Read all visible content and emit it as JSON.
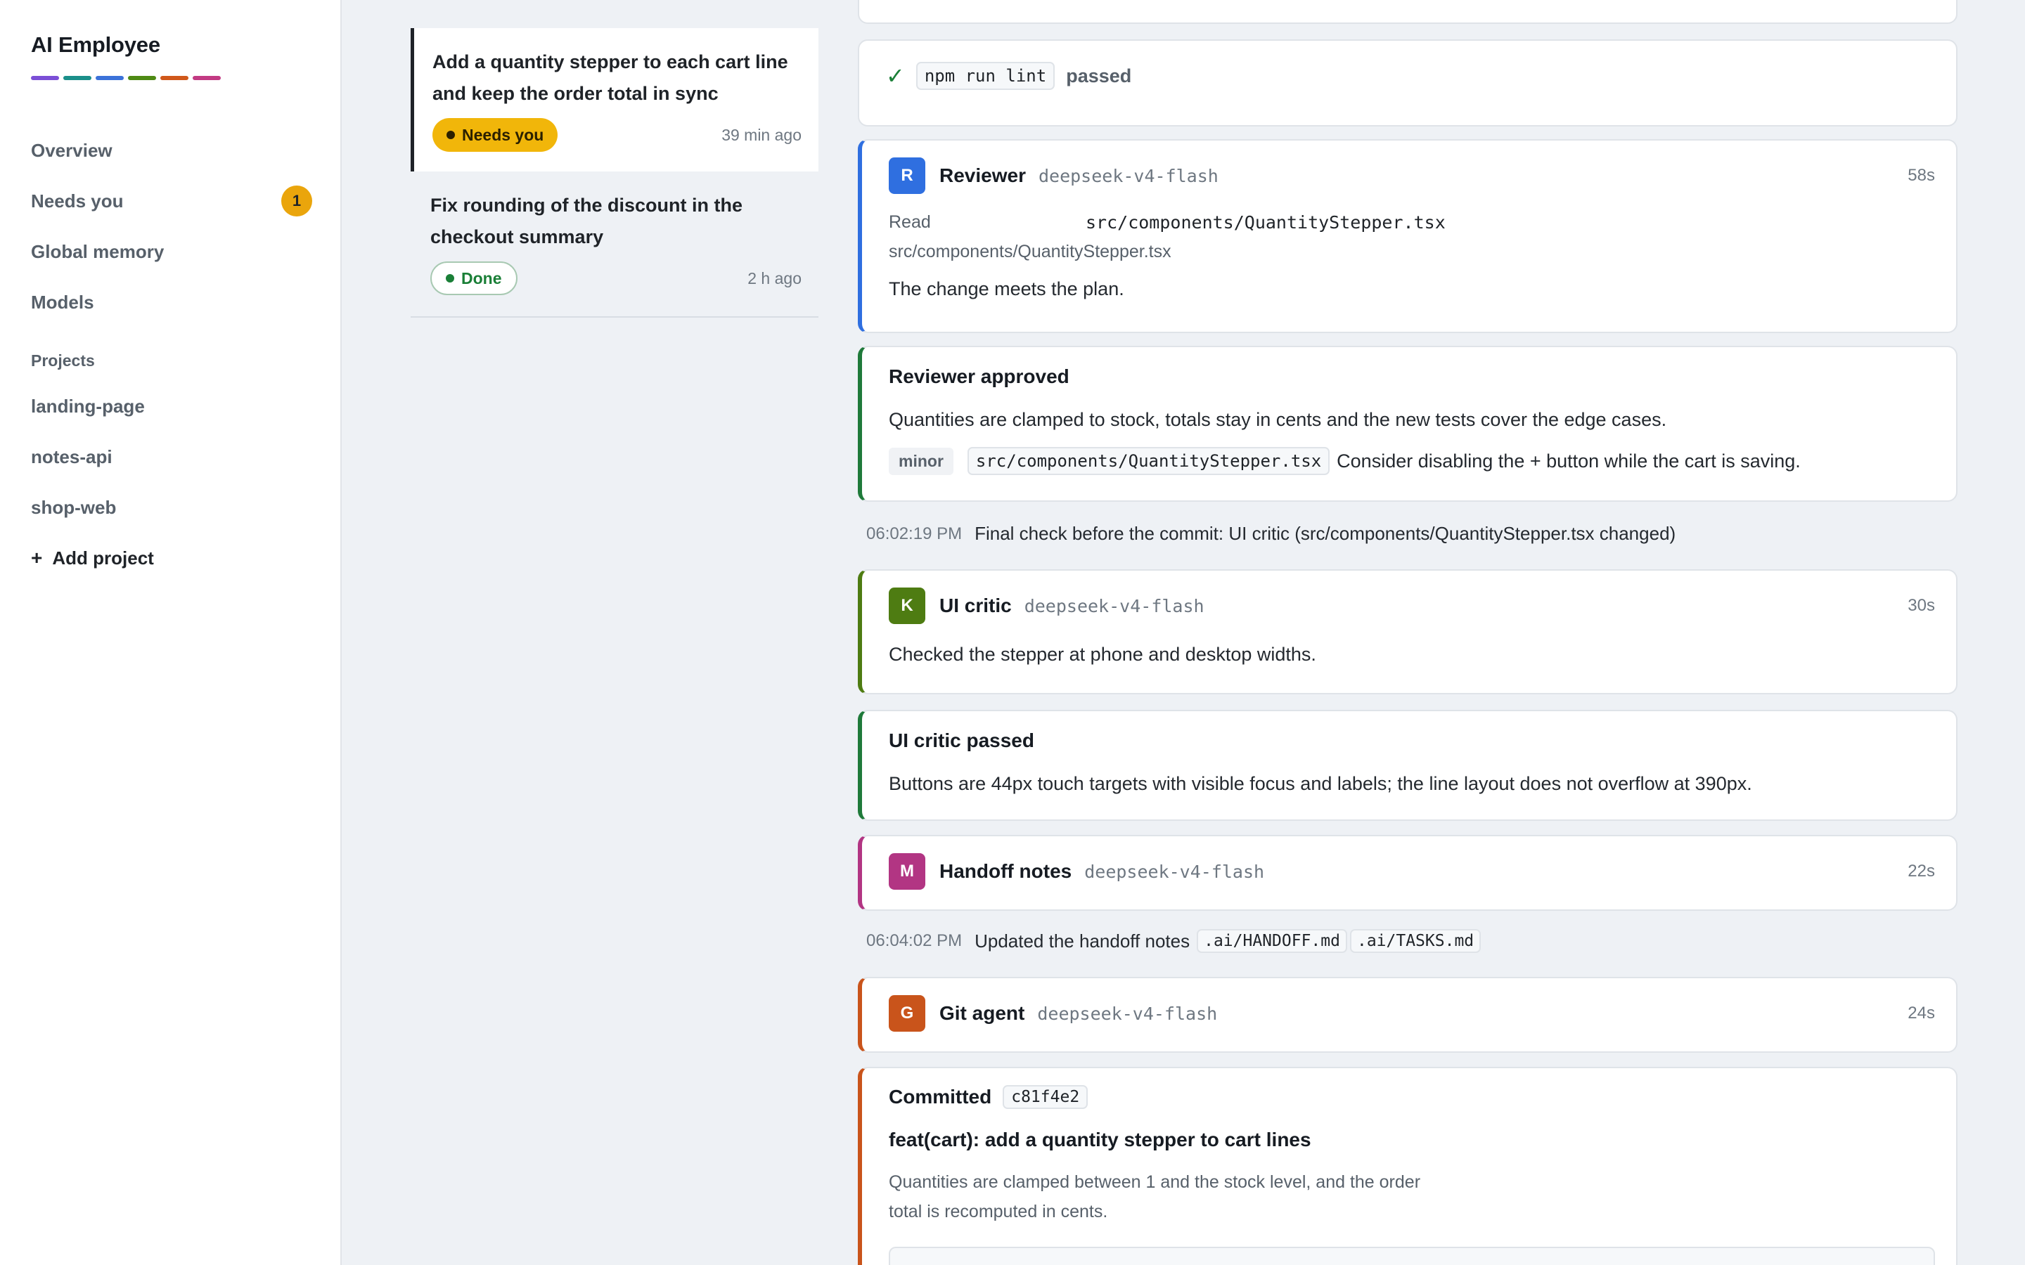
{
  "app": {
    "title": "AI Employee",
    "strip_colors": [
      "#7b4fd6",
      "#1b8f8a",
      "#3b72d9",
      "#4e8a14",
      "#d0581b",
      "#c23a83"
    ]
  },
  "sidebar": {
    "nav": [
      {
        "label": "Overview"
      },
      {
        "label": "Needs you",
        "badge": "1"
      },
      {
        "label": "Global memory"
      },
      {
        "label": "Models"
      }
    ],
    "projects_heading": "Projects",
    "projects": [
      "landing-page",
      "notes-api",
      "shop-web"
    ],
    "add_project": {
      "icon": "plus-icon",
      "label": "Add project"
    }
  },
  "tasks": [
    {
      "title": "Add a quantity stepper to each cart line and keep the order total in sync",
      "status": "Needs you",
      "time": "39 min ago",
      "active": true
    },
    {
      "title": "Fix rounding of the discount in the checkout summary",
      "status": "Done",
      "time": "2 h ago",
      "active": false
    }
  ],
  "timeline": {
    "lint": {
      "icon": "check-icon",
      "command": "npm run lint",
      "result": "passed"
    },
    "reviewer": {
      "initial": "R",
      "name": "Reviewer",
      "model": "deepseek-v4-flash",
      "duration": "58s",
      "color": "#2f6fe0",
      "read_label": "Read",
      "read_file": "src/components/QuantityStepper.tsx",
      "read_path": "src/components/QuantityStepper.tsx",
      "message": "The change meets the plan."
    },
    "reviewer_approved": {
      "title": "Reviewer approved",
      "body": "Quantities are clamped to stock, totals stay in cents and the new tests cover the edge cases.",
      "severity": "minor",
      "file": "src/components/QuantityStepper.tsx",
      "note": "Consider disabling the + button while the cart is saving."
    },
    "log1": {
      "time": "06:02:19 PM",
      "text": "Final check before the commit: UI critic (src/components/QuantityStepper.tsx changed)"
    },
    "ui_critic": {
      "initial": "K",
      "name": "UI critic",
      "model": "deepseek-v4-flash",
      "duration": "30s",
      "color": "#4e7c12",
      "message": "Checked the stepper at phone and desktop widths."
    },
    "ui_critic_passed": {
      "title": "UI critic passed",
      "body": "Buttons are 44px touch targets with visible focus and labels; the line layout does not overflow at 390px."
    },
    "handoff": {
      "initial": "M",
      "name": "Handoff notes",
      "model": "deepseek-v4-flash",
      "duration": "22s",
      "color": "#b23583"
    },
    "log2": {
      "time": "06:04:02 PM",
      "text": "Updated the handoff notes",
      "files": [
        ".ai/HANDOFF.md",
        ".ai/TASKS.md"
      ]
    },
    "git": {
      "initial": "G",
      "name": "Git agent",
      "model": "deepseek-v4-flash",
      "duration": "24s",
      "color": "#c9541b"
    },
    "committed": {
      "title": "Committed",
      "hash": "c81f4e2",
      "message": "feat(cart): add a quantity stepper to cart lines",
      "body_line1": "Quantities are clamped between 1 and the stock level, and the order",
      "body_line2": "total is recomputed in cents."
    }
  }
}
